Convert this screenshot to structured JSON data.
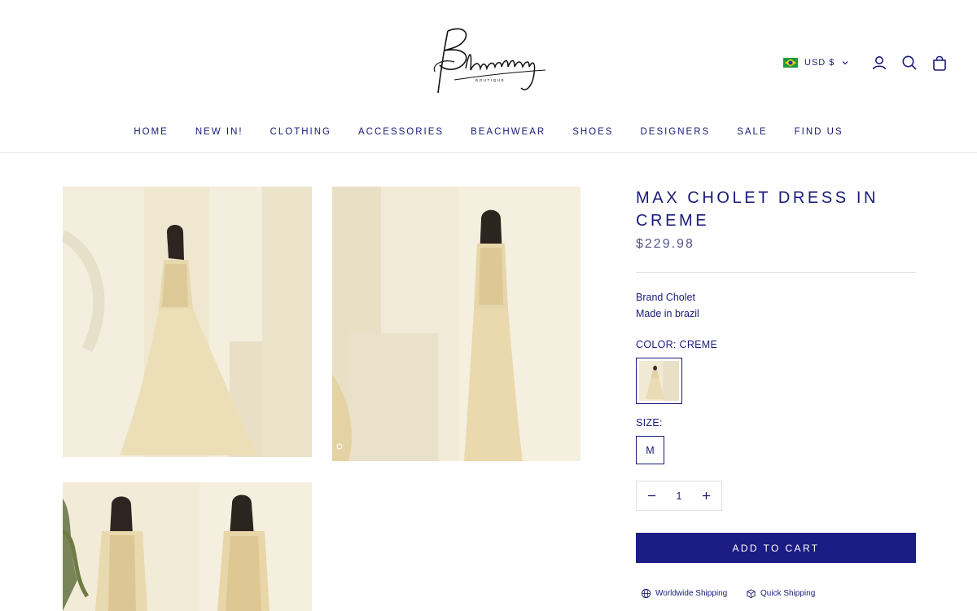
{
  "logo": {
    "name": "Blueberry",
    "sub": "BOUTIQUE"
  },
  "header": {
    "currency": "USD $",
    "icons": [
      "brazil-flag-icon",
      "chevron-down-icon",
      "account-icon",
      "search-icon",
      "bag-icon"
    ]
  },
  "nav": {
    "items": [
      {
        "label": "HOME"
      },
      {
        "label": "NEW IN!"
      },
      {
        "label": "CLOTHING"
      },
      {
        "label": "ACCESSORIES"
      },
      {
        "label": "BEACHWEAR"
      },
      {
        "label": "SHOES"
      },
      {
        "label": "DESIGNERS"
      },
      {
        "label": "SALE"
      },
      {
        "label": "FIND US"
      }
    ]
  },
  "product": {
    "title": "MAX CHOLET DRESS IN CREME",
    "price": "$229.98",
    "brand": "Brand Cholet",
    "origin": "Made in brazil",
    "color_label": "COLOR: CREME",
    "size_label": "SIZE:",
    "size_value": "M",
    "quantity": "1",
    "add_to_cart": "ADD TO CART"
  },
  "perks": [
    {
      "icon": "globe-icon",
      "label": "Worldwide Shipping"
    },
    {
      "icon": "box-icon",
      "label": "Quick Shipping"
    }
  ],
  "colors": {
    "accent": "#1b1c84",
    "text": "#1a1a7a",
    "price": "#55558f",
    "dress": "#e9dcb4",
    "backdrop": "#f2ecd9"
  }
}
